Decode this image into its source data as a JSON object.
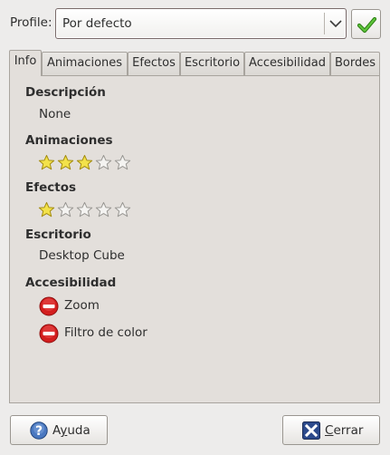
{
  "profile": {
    "label": "Profile:",
    "selected": "Por defecto"
  },
  "tabs": [
    {
      "label": "Info",
      "active": true
    },
    {
      "label": "Animaciones",
      "active": false
    },
    {
      "label": "Efectos",
      "active": false
    },
    {
      "label": "Escritorio",
      "active": false
    },
    {
      "label": "Accesibilidad",
      "active": false
    },
    {
      "label": "Bordes",
      "active": false
    }
  ],
  "info": {
    "description_title": "Descripción",
    "description_value": "None",
    "animations_title": "Animaciones",
    "animations_rating": 3,
    "effects_title": "Efectos",
    "effects_rating": 1,
    "rating_max": 5,
    "desktop_title": "Escritorio",
    "desktop_value": "Desktop Cube",
    "accessibility_title": "Accesibilidad",
    "accessibility_items": [
      "Zoom",
      "Filtro de color"
    ]
  },
  "buttons": {
    "help_label_mnemonic": "y",
    "help_label_prefix": "A",
    "help_label_rest": "uda",
    "close_label_mnemonic": "C",
    "close_label_rest": "errar"
  },
  "colors": {
    "star_filled": "#f3e24a",
    "star_empty": "#f4f3f1",
    "check": "#3da31f",
    "no_icon": "#d01c1c",
    "help_icon": "#3a6ab3",
    "close_icon": "#2a3f7a"
  },
  "icons": {
    "apply": "checkmark-icon",
    "combo": "chevron-down-icon",
    "rating": "star-icon",
    "accessibility": "no-entry-icon",
    "help": "help-icon",
    "close": "close-icon"
  }
}
